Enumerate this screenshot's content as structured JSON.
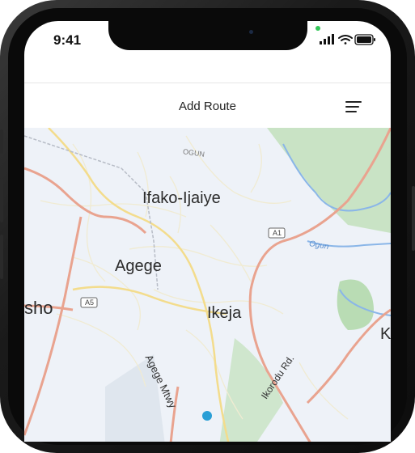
{
  "status_bar": {
    "time": "9:41",
    "icons": [
      "cellular-signal-icon",
      "wifi-icon",
      "battery-icon"
    ]
  },
  "header": {
    "title": "Add Route",
    "menu_icon": "hamburger-menu-icon"
  },
  "map": {
    "places": {
      "ifako_ijaiye": "Ifako-Ijaiye",
      "agege": "Agege",
      "ikeja": "Ikeja",
      "osho": "sho",
      "k": "K"
    },
    "roads": {
      "ogun_road": "OGUN",
      "a1": "A1",
      "a5": "A5",
      "agege_motor": "Agege Mtwy",
      "ikorodu": "Ikorodu Rd."
    },
    "water": {
      "ogun_river": "Ogun"
    }
  },
  "colors": {
    "map_background": "#eef2f8",
    "major_road": "#e9a38f",
    "secondary_road": "#f3dc8c",
    "park": "#b9dcb4",
    "river": "#8ab6e8"
  }
}
